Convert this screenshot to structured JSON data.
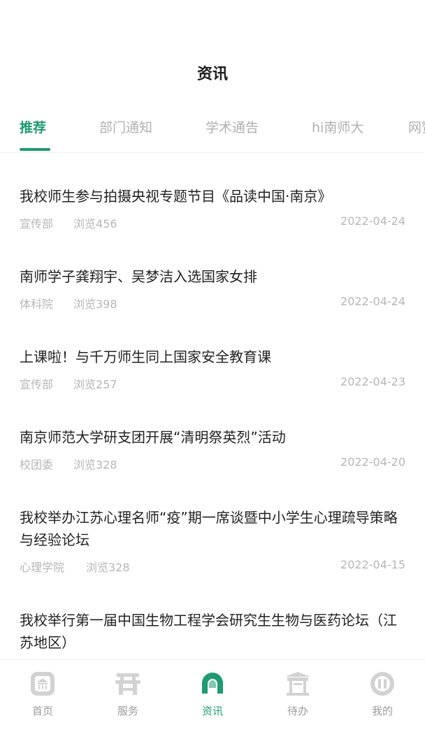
{
  "header": {
    "title": "资讯"
  },
  "tabs": [
    {
      "label": "推荐",
      "active": true
    },
    {
      "label": "部门通知",
      "active": false
    },
    {
      "label": "学术通告",
      "active": false
    },
    {
      "label": "hi南师大",
      "active": false
    },
    {
      "label": "网赞",
      "active": false
    }
  ],
  "news": [
    {
      "title": "我校师生参与拍摄央视专题节目《品读中国·南京》",
      "source": "宣传部",
      "views": "浏览456",
      "date": "2022-04-24"
    },
    {
      "title": "南师学子龚翔宇、吴梦洁入选国家女排",
      "source": "体科院",
      "views": "浏览398",
      "date": "2022-04-24"
    },
    {
      "title": "上课啦！与千万师生同上国家安全教育课",
      "source": "宣传部",
      "views": "浏览257",
      "date": "2022-04-23"
    },
    {
      "title": "南京师范大学研支团开展“清明祭英烈”活动",
      "source": "校团委",
      "views": "浏览328",
      "date": "2022-04-20"
    },
    {
      "title": "我校举办江苏心理名师“疫”期一席谈暨中小学生心理疏导策略与经验论坛",
      "source": "心理学院",
      "views": "浏览328",
      "date": "2022-04-15"
    },
    {
      "title": "我校举行第一届中国生物工程学会研究生生物与医药论坛（江苏地区）",
      "source": "",
      "views": "",
      "date": ""
    }
  ],
  "tabbar": [
    {
      "label": "首页",
      "icon": "home-icon",
      "active": false
    },
    {
      "label": "服务",
      "icon": "service-icon",
      "active": false
    },
    {
      "label": "资讯",
      "icon": "news-icon",
      "active": true
    },
    {
      "label": "待办",
      "icon": "todo-icon",
      "active": false
    },
    {
      "label": "我的",
      "icon": "profile-icon",
      "active": false
    }
  ],
  "colors": {
    "accent": "#1e9b72",
    "inactive": "#b0b0b0",
    "icon_inactive": "#d0d0d0"
  }
}
